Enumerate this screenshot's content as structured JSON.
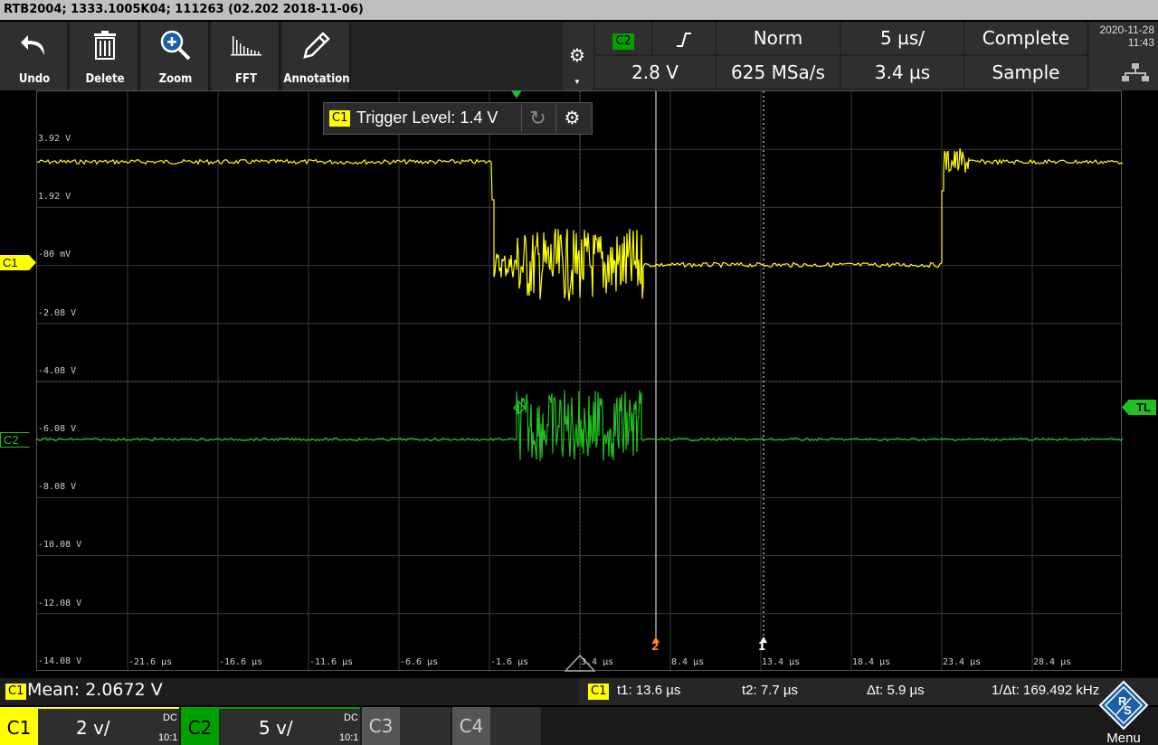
{
  "title_bar": "RTB2004; 1333.1005K04; 111263 (02.202 2018-11-06)",
  "toolbar": {
    "tools": [
      {
        "label": "Undo",
        "icon": "undo-icon"
      },
      {
        "label": "Delete",
        "icon": "trash-icon"
      },
      {
        "label": "Zoom",
        "icon": "zoom-icon"
      },
      {
        "label": "FFT",
        "icon": "fft-icon"
      },
      {
        "label": "Annotation",
        "icon": "pencil-icon"
      }
    ],
    "settings_icon": "gear-icon"
  },
  "trigger_panel": {
    "source": "C2",
    "slope_icon": "rising-edge-icon",
    "mode": "Norm",
    "timebase": "5 µs/",
    "acq_state": "Complete",
    "level": "2.8 V",
    "sample_rate": "625 MSa/s",
    "position": "3.4 µs",
    "acq_mode": "Sample"
  },
  "datetime": {
    "date": "2020-11-28",
    "time": "11:43"
  },
  "trigger_popup": {
    "channel": "C1",
    "text": "Trigger Level: 1.4 V"
  },
  "y_labels": [
    "3.92 V",
    "1.92 V",
    "-80 mV",
    "-2.08 V",
    "-4.08 V",
    "-6.08 V",
    "-8.08 V",
    "-10.08 V",
    "-12.08 V",
    "-14.08 V"
  ],
  "x_labels": [
    "-21.6 µs",
    "-16.6 µs",
    "-11.6 µs",
    "-6.6 µs",
    "-1.6 µs",
    "3.4 µs",
    "8.4 µs",
    "13.4 µs",
    "18.4 µs",
    "23.4 µs",
    "28.4 µs"
  ],
  "markers": {
    "c1": "C1",
    "c2": "C2",
    "tl": "TL",
    "cursor1": "1",
    "cursor2": "2"
  },
  "measurement": {
    "channel": "C1",
    "text": "Mean: 2.0672 V"
  },
  "cursors": {
    "channel": "C1",
    "t1": "t1: 13.6 µs",
    "t2": "t2: 7.7 µs",
    "dt": "Δt: 5.9 µs",
    "inv_dt": "1/Δt: 169.492 kHz"
  },
  "channels": [
    {
      "name": "C1",
      "scale": "2 v/",
      "coupling": "DC",
      "ratio": "10:1",
      "color": "#ffff00"
    },
    {
      "name": "C2",
      "scale": "5 v/",
      "coupling": "DC",
      "ratio": "10:1",
      "color": "#00a000"
    },
    {
      "name": "C3"
    },
    {
      "name": "C4"
    }
  ],
  "menu_label": "Menu",
  "colors": {
    "c1": "#ffff00",
    "c2": "#20c020",
    "cursor2": "#ff8c00"
  }
}
